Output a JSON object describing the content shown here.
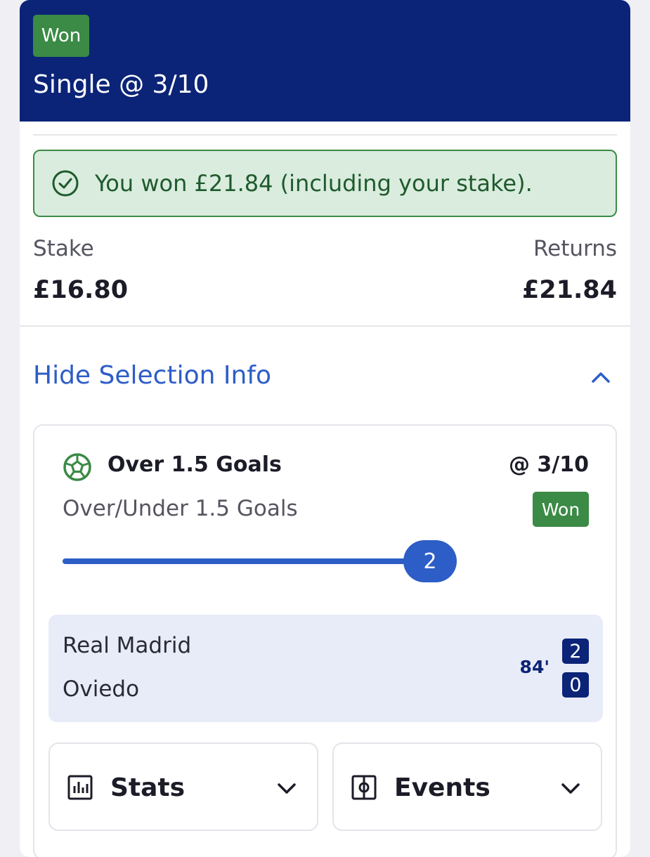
{
  "header": {
    "status_badge": "Won",
    "bet_title": "Single @ 3/10"
  },
  "win_banner": {
    "text": "You won £21.84 (including your stake).",
    "icon": "check-circle-icon"
  },
  "summary": {
    "stake_label": "Stake",
    "stake_value": "£16.80",
    "returns_label": "Returns",
    "returns_value": "£21.84"
  },
  "toggle": {
    "label": "Hide Selection Info",
    "icon": "chevron-up-icon"
  },
  "selection": {
    "icon": "football-icon",
    "name": "Over 1.5 Goals",
    "odds": "@ 3/10",
    "market": "Over/Under 1.5 Goals",
    "status": "Won",
    "progress_value": "2"
  },
  "match": {
    "home_team": "Real Madrid",
    "away_team": "Oviedo",
    "minute": "84'",
    "home_score": "2",
    "away_score": "0"
  },
  "tabs": [
    {
      "label": "Stats",
      "icon": "bar-chart-icon"
    },
    {
      "label": "Events",
      "icon": "pitch-icon"
    }
  ],
  "colors": {
    "header_bg": "#0b2477",
    "won_green": "#3b8a45",
    "accent_blue": "#2d5dc7",
    "banner_bg": "#d9ecde"
  }
}
